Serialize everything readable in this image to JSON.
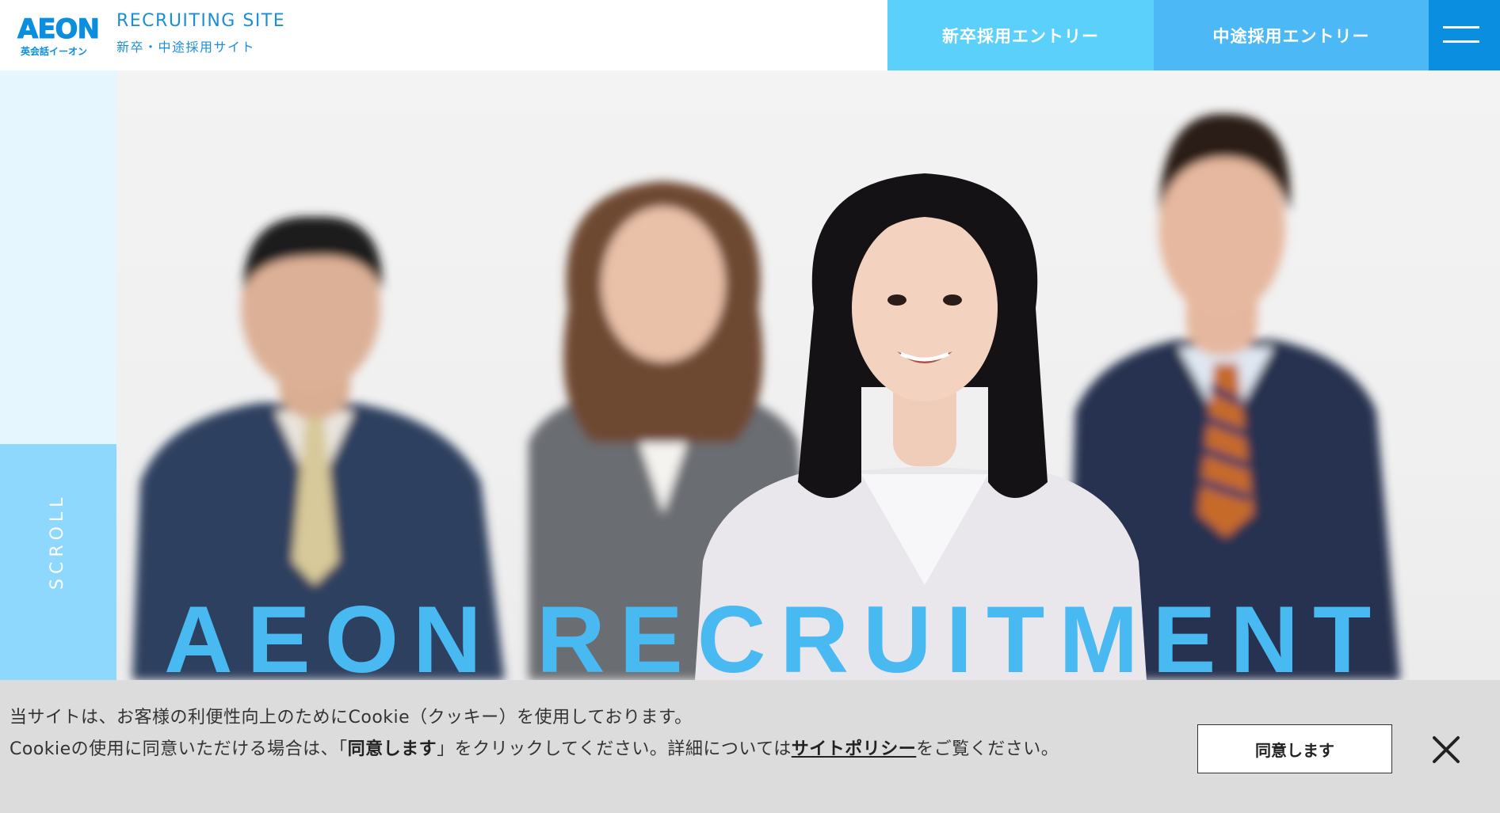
{
  "header": {
    "logo_text": "AEON",
    "logo_sub": "英会話イーオン",
    "site_title": "RECRUITING SITE",
    "site_subtitle": "新卒・中途採用サイト",
    "nav_new_grad": "新卒採用エントリー",
    "nav_mid_career": "中途採用エントリー",
    "menu_icon": "hamburger-icon"
  },
  "sidebar": {
    "scroll_label": "SCROLL"
  },
  "hero": {
    "image_alt": "staff-group-photo"
  },
  "cookie": {
    "line1": "当サイトは、お客様の利便性向上のためにCookie（クッキー）を使用しております。",
    "line2_pre": "Cookieの使用に同意いただける場合は、「",
    "line2_bold": "同意します",
    "line2_mid": "」をクリックしてください。詳細については",
    "policy_link": "サイトポリシー",
    "line2_post": "をご覧ください。",
    "agree_label": "同意します",
    "close_icon": "close-icon"
  },
  "colors": {
    "brand": "#0a8fe0",
    "nav_new": "#5bd0fb",
    "nav_mid": "#4cb8f6",
    "stripe_light": "#e5f6fe",
    "stripe_dark": "#8fd8fd",
    "cookie_bg": "#dcdcdc"
  }
}
